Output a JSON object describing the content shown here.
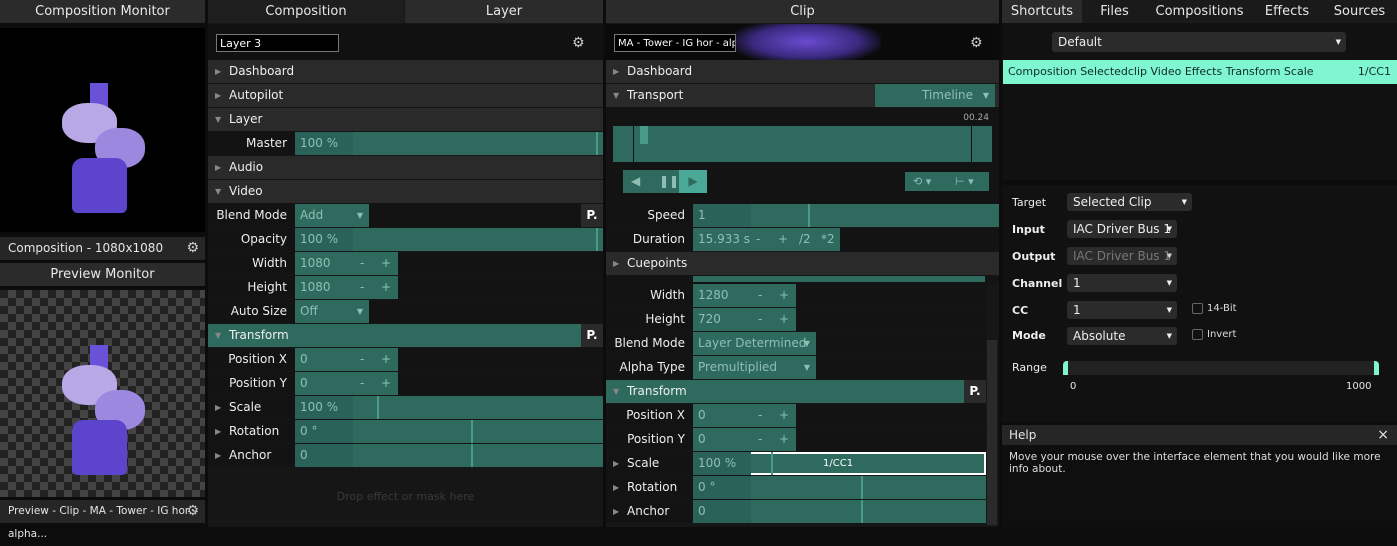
{
  "left": {
    "comp_monitor_title": "Composition Monitor",
    "comp_footer": "Composition - 1080x1080",
    "preview_monitor_title": "Preview Monitor",
    "preview_footer": "Preview - Clip - MA - Tower - IG hor - alpha..."
  },
  "layer_panel": {
    "tabs": [
      "Composition",
      "Layer"
    ],
    "active_tab": "Layer",
    "name": "Layer 3",
    "drop_hint": "Drop effect or mask here",
    "rows": [
      {
        "kind": "section",
        "label": "Dashboard",
        "open": false
      },
      {
        "kind": "section",
        "label": "Autopilot",
        "open": false
      },
      {
        "kind": "section",
        "label": "Layer",
        "open": true
      },
      {
        "kind": "slider",
        "label": "Master",
        "value": "100 %",
        "level": 0.99
      },
      {
        "kind": "section",
        "label": "Audio",
        "open": false
      },
      {
        "kind": "section",
        "label": "Video",
        "open": true
      },
      {
        "kind": "dropdown",
        "label": "Blend Mode",
        "value": "Add",
        "p": "P."
      },
      {
        "kind": "slider",
        "label": "Opacity",
        "value": "100 %",
        "level": 0.99
      },
      {
        "kind": "stepper",
        "label": "Width",
        "value": "1080"
      },
      {
        "kind": "stepper",
        "label": "Height",
        "value": "1080"
      },
      {
        "kind": "dropdown",
        "label": "Auto Size",
        "value": "Off"
      },
      {
        "kind": "section",
        "label": "Transform",
        "open": true,
        "teal": true,
        "p": "P."
      },
      {
        "kind": "stepper",
        "label": "Position X",
        "value": "0"
      },
      {
        "kind": "stepper",
        "label": "Position Y",
        "value": "0"
      },
      {
        "kind": "slider",
        "label": "Scale",
        "value": "100 %",
        "level": 0.27,
        "expand": true
      },
      {
        "kind": "slider",
        "label": "Rotation",
        "value": "0 °",
        "level": 0.58,
        "expand": true
      },
      {
        "kind": "slider",
        "label": "Anchor",
        "value": "0",
        "level": 0.58,
        "expand": true
      }
    ]
  },
  "clip_panel": {
    "title": "Clip",
    "name": "MA - Tower - IG hor - alpha",
    "timecode": "00.24",
    "playhead": 0.02,
    "rows_top": [
      {
        "kind": "section",
        "label": "Dashboard",
        "open": false
      },
      {
        "kind": "section",
        "label": "Transport",
        "open": true,
        "dropdown": "Timeline"
      }
    ],
    "rows_mid": [
      {
        "kind": "slider",
        "label": "Speed",
        "value": "1",
        "level": 0.38
      },
      {
        "kind": "duration",
        "label": "Duration",
        "value": "15.933 s",
        "buttons": [
          "-",
          "+",
          "/2",
          "*2"
        ]
      },
      {
        "kind": "section",
        "label": "Cuepoints",
        "open": false
      }
    ],
    "rows_bottom": [
      {
        "kind": "stepper",
        "label": "Width",
        "value": "1280"
      },
      {
        "kind": "stepper",
        "label": "Height",
        "value": "720"
      },
      {
        "kind": "dropdown",
        "label": "Blend Mode",
        "value": "Layer Determined"
      },
      {
        "kind": "dropdown",
        "label": "Alpha Type",
        "value": "Premultiplied"
      },
      {
        "kind": "section",
        "label": "Transform",
        "open": true,
        "teal": true,
        "p": "P."
      },
      {
        "kind": "stepper",
        "label": "Position X",
        "value": "0"
      },
      {
        "kind": "stepper",
        "label": "Position Y",
        "value": "0"
      },
      {
        "kind": "slider",
        "label": "Scale",
        "value": "100 %",
        "level": 0.27,
        "expand": true,
        "mapping": "1/CC1",
        "selected": true
      },
      {
        "kind": "slider",
        "label": "Rotation",
        "value": "0 °",
        "level": 0.58,
        "expand": true
      },
      {
        "kind": "slider",
        "label": "Anchor",
        "value": "0",
        "level": 0.58,
        "expand": true
      }
    ]
  },
  "right": {
    "tabs": [
      "Shortcuts",
      "Files",
      "Compositions",
      "Effects",
      "Sources"
    ],
    "active_tab": "Shortcuts",
    "preset": "Default",
    "shortcut": {
      "path": "Composition Selectedclip Video Effects Transform Scale",
      "mapping": "1/CC1"
    },
    "settings": {
      "target_label": "Target",
      "target": "Selected Clip",
      "input_label": "Input",
      "input": "IAC Driver Bus 1",
      "output_label": "Output",
      "output": "IAC Driver Bus 1",
      "channel_label": "Channel",
      "channel": "1",
      "cc_label": "CC",
      "cc": "1",
      "bit14": "14-Bit",
      "mode_label": "Mode",
      "mode": "Absolute",
      "invert": "Invert",
      "range_label": "Range",
      "range_min": "0",
      "range_max": "1000"
    },
    "help": {
      "title": "Help",
      "close": "×",
      "text": "Move your mouse over the interface element that you would like more info about."
    }
  },
  "colors": {
    "accent": "#2f6a5f",
    "highlight": "#7ff5d0"
  }
}
